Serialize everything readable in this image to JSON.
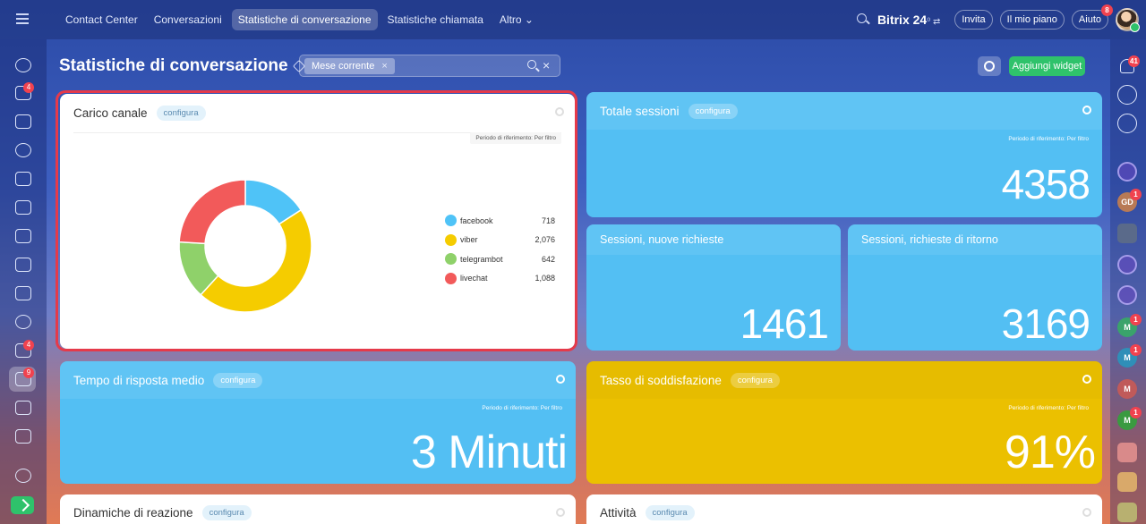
{
  "topbar": {
    "nav": [
      "Contact Center",
      "Conversazioni",
      "Statistiche di conversazione",
      "Statistiche chiamata",
      "Altro ⌄"
    ],
    "active_index": 2,
    "brand": "Bitrix 24",
    "brand_suffix": "⁰ ⇄",
    "invite": "Invita",
    "my_plan": "Il mio piano",
    "help": "Aiuto",
    "help_badge": "8"
  },
  "page": {
    "title": "Statistiche di conversazione",
    "filter_chip": "Mese corrente",
    "filter_chip_close": "×",
    "filter_clear": "×",
    "add_widget": "Aggiungi widget"
  },
  "left_badges": [
    "4",
    "4",
    "9"
  ],
  "right_sidebar": {
    "bell_badge": "41",
    "avatars": [
      {
        "initials": "GD",
        "color": "#b87a55",
        "badge": "1"
      },
      {
        "initials": "M",
        "color": "#3aa36b",
        "badge": "1"
      },
      {
        "initials": "M",
        "color": "#2f8fb8",
        "badge": "1"
      },
      {
        "initials": "M",
        "color": "#c05a5a",
        "badge": ""
      },
      {
        "initials": "M",
        "color": "#3a9a40",
        "badge": "1"
      }
    ]
  },
  "widgets": {
    "carico": {
      "title": "Carico canale",
      "configure": "configura",
      "period": "Periodo di riferimento: Per filtro",
      "legend": [
        {
          "label": "facebook",
          "value": "718",
          "color": "#4fc3f7"
        },
        {
          "label": "viber",
          "value": "2,076",
          "color": "#f5cc00"
        },
        {
          "label": "telegrambot",
          "value": "642",
          "color": "#8fd16a"
        },
        {
          "label": "livechat",
          "value": "1,088",
          "color": "#f25a5a"
        }
      ]
    },
    "totale": {
      "title": "Totale sessioni",
      "configure": "configura",
      "period": "Periodo di riferimento: Per filtro",
      "value": "4358"
    },
    "nuove": {
      "title": "Sessioni, nuove richieste",
      "value": "1461"
    },
    "ritorno": {
      "title": "Sessioni, richieste di ritorno",
      "value": "3169"
    },
    "tempo": {
      "title": "Tempo di risposta medio",
      "configure": "configura",
      "period": "Periodo di riferimento: Per filtro",
      "value": "3 Minuti"
    },
    "tasso": {
      "title": "Tasso di soddisfazione",
      "configure": "configura",
      "period": "Periodo di riferimento: Per filtro",
      "value": "91%"
    },
    "dinamiche": {
      "title": "Dinamiche di reazione",
      "configure": "configura"
    },
    "attivita": {
      "title": "Attività",
      "configure": "configura"
    }
  },
  "chart_data": {
    "type": "pie",
    "categories": [
      "facebook",
      "viber",
      "telegrambot",
      "livechat"
    ],
    "values": [
      718,
      2076,
      642,
      1088
    ],
    "colors": [
      "#4fc3f7",
      "#f5cc00",
      "#8fd16a",
      "#f25a5a"
    ],
    "title": "Carico canale"
  }
}
